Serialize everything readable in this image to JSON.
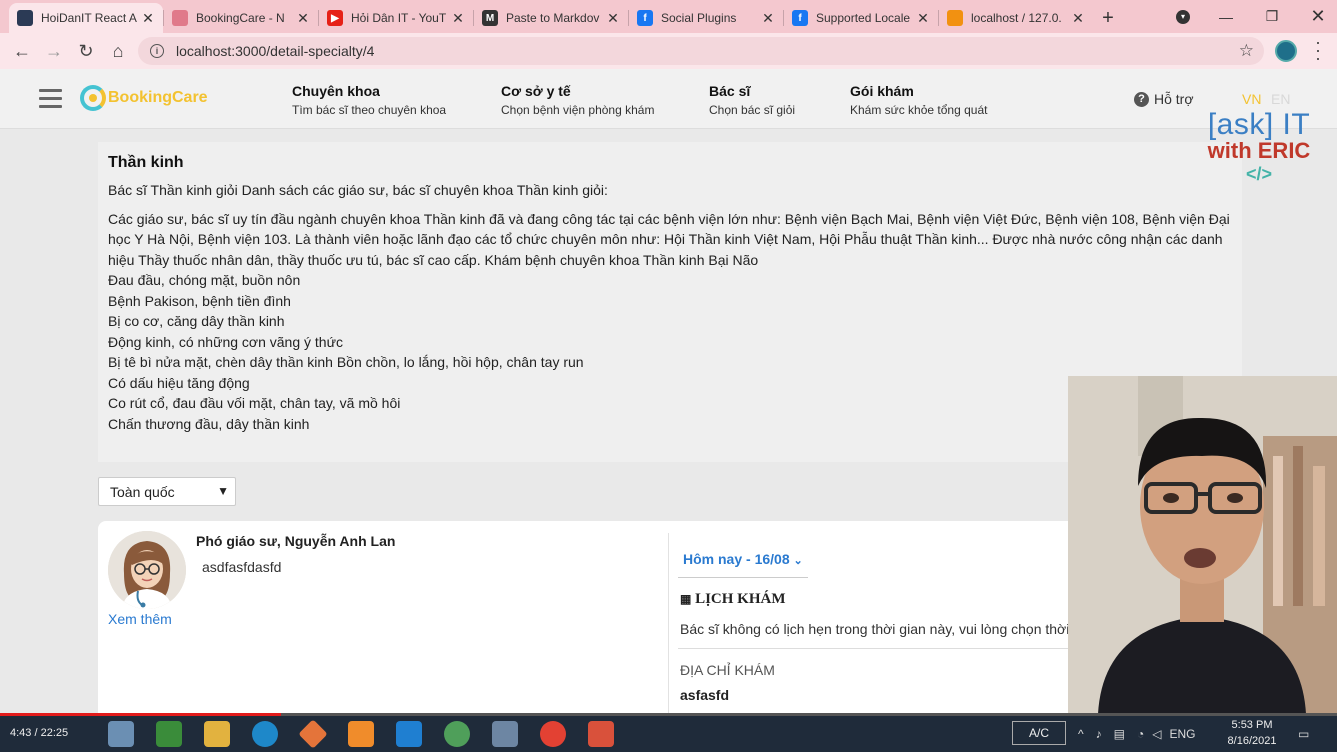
{
  "browser": {
    "tabs": [
      {
        "title": "HoiDanIT React A",
        "fav_color": "#2b3a55",
        "fav_char": "",
        "active": true
      },
      {
        "title": "BookingCare - N",
        "fav_color": "#e07a8a",
        "fav_char": "",
        "active": false
      },
      {
        "title": "Hỏi Dân IT - YouT",
        "fav_color": "#e62117",
        "fav_char": "▶",
        "active": false
      },
      {
        "title": "Paste to Markdov",
        "fav_color": "#333333",
        "fav_char": "M",
        "active": false
      },
      {
        "title": "Social Plugins",
        "fav_color": "#1877f2",
        "fav_char": "f",
        "active": false
      },
      {
        "title": "Supported Locale",
        "fav_color": "#1877f2",
        "fav_char": "f",
        "active": false
      },
      {
        "title": "localhost / 127.0.",
        "fav_color": "#f29111",
        "fav_char": "",
        "active": false
      }
    ],
    "new_tab": "+",
    "url": "localhost:3000/detail-specialty/4"
  },
  "header": {
    "logo_text": "BookingCare",
    "nav": [
      {
        "title": "Chuyên khoa",
        "sub": "Tìm bác sĩ theo chuyên khoa"
      },
      {
        "title": "Cơ sở y tế",
        "sub": "Chọn bệnh viện phòng khám"
      },
      {
        "title": "Bác sĩ",
        "sub": "Chọn bác sĩ giỏi"
      },
      {
        "title": "Gói khám",
        "sub": "Khám sức khỏe tổng quát"
      }
    ],
    "support": "Hỗ trợ",
    "lang_vn": "VN",
    "lang_en": "EN",
    "lang_vn_color": "#f3c230",
    "lang_en_color": "#d8d8d8"
  },
  "watermark": {
    "line1": "[ask] IT",
    "line2": "with ERIC",
    "line3": "</>"
  },
  "specialty": {
    "name": "Thần kinh",
    "intro": "Bác sĩ Thần kinh giỏi Danh sách các giáo sư, bác sĩ chuyên khoa Thần kinh giỏi:",
    "para": "Các giáo sư, bác sĩ uy tín đầu ngành chuyên khoa Thần kinh đã và đang công tác tại các bệnh viện lớn như: Bệnh viện Bạch Mai, Bệnh viện Việt Đức, Bệnh viện 108, Bệnh viện Đại học Y Hà Nội, Bệnh viện 103. Là thành viên hoặc lãnh đạo các tổ chức chuyên môn như: Hội Thần kinh Việt Nam, Hội Phẫu thuật Thần kinh... Được nhà nước công nhận các danh hiệu Thầy thuốc nhân dân, thầy thuốc ưu tú, bác sĩ cao cấp. Khám bệnh chuyên khoa Thần kinh Bại Não",
    "items": [
      "Đau đầu, chóng mặt, buồn nôn",
      "Bệnh Pakison, bệnh tiền đình",
      "Bị co cơ, căng dây thần kinh",
      "Động kinh, có những cơn vãng ý thức",
      "Bị tê bì nửa mặt, chèn dây thần kinh Bồn chồn, lo lắng, hồi hộp, chân tay run",
      "Có dấu hiệu tăng động",
      "Co rút cổ, đau đầu vối mặt, chân tay, vã mồ hôi",
      "Chấn thương đầu, dây thần kinh"
    ]
  },
  "filter": {
    "province": "Toàn quốc"
  },
  "doctor": {
    "name": "Phó giáo sư, Nguyễn Anh Lan",
    "description": "asdfasfdasfd",
    "more": "Xem thêm",
    "date": "Hôm nay - 16/08",
    "schedule_title": "LỊCH KHÁM",
    "schedule_note": "Bác sĩ không có lịch hẹn trong thời gian này, vui lòng chọn thời g",
    "address_label": "ĐỊA CHỈ KHÁM",
    "address_value": "asfasfd"
  },
  "video": {
    "time": "4:43 / 22:25",
    "progress": 0.21
  },
  "taskbar": {
    "ac_label": "A/C",
    "lang": "ENG",
    "time": "5:53 PM",
    "date": "8/16/2021"
  }
}
